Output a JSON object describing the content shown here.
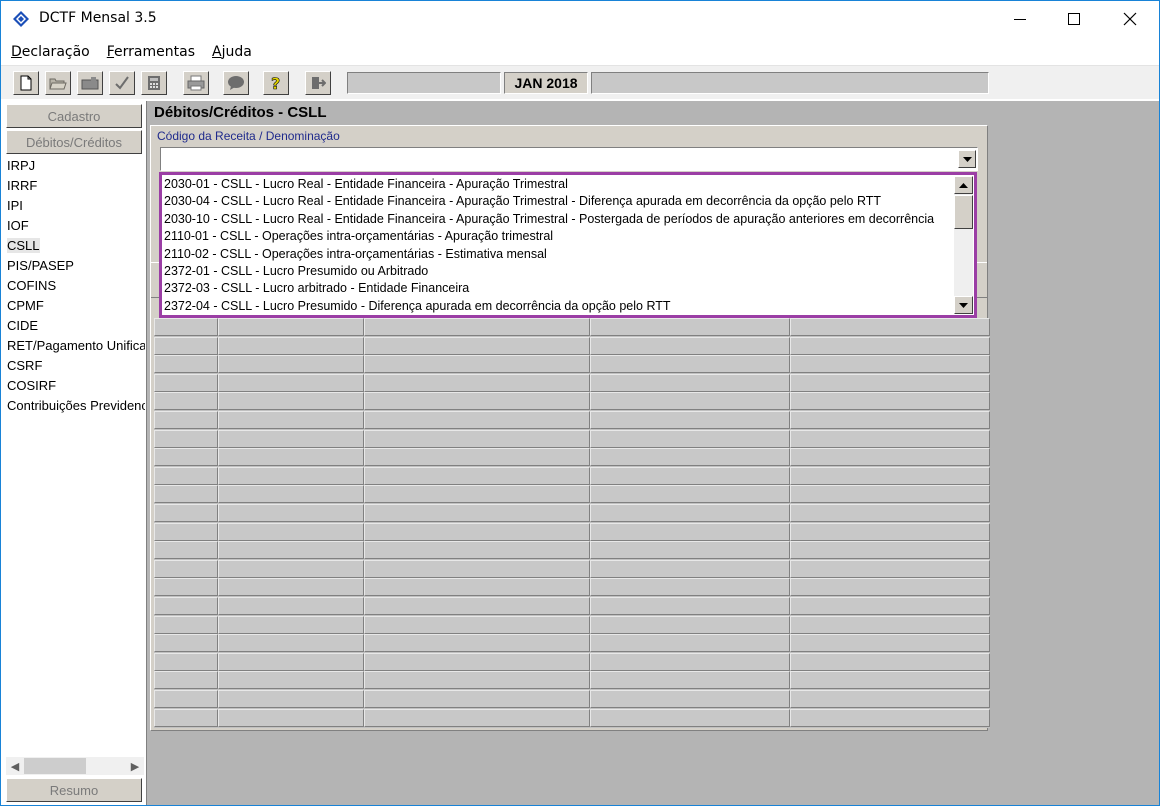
{
  "window": {
    "title": "DCTF Mensal 3.5"
  },
  "menu": {
    "items": [
      {
        "accel": "D",
        "rest": "eclaração"
      },
      {
        "accel": "F",
        "rest": "erramentas"
      },
      {
        "accel": "A",
        "rest": "juda"
      }
    ]
  },
  "toolbar": {
    "period": "JAN 2018",
    "icons": [
      "new-file-icon",
      "open-folder-icon",
      "save-icon",
      "check-icon",
      "calculator-icon",
      "print-icon",
      "speech-icon",
      "help-icon",
      "exit-icon"
    ]
  },
  "sidebar": {
    "cadastro_label": "Cadastro",
    "debitos_label": "Débitos/Créditos",
    "items": [
      "IRPJ",
      "IRRF",
      "IPI",
      "IOF",
      "CSLL",
      "PIS/PASEP",
      "COFINS",
      "CPMF",
      "CIDE",
      "RET/Pagamento Unificado",
      "CSRF",
      "COSIRF",
      "Contribuições Previdenciárias"
    ],
    "selected_index": 4,
    "resumo_label": "Resumo"
  },
  "main": {
    "title": "Débitos/Créditos - CSLL",
    "field_label": "Código da Receita / Denominação",
    "combo_value": ""
  },
  "dropdown": {
    "options": [
      "2030-01 - CSLL - Lucro Real - Entidade Financeira - Apuração Trimestral",
      "2030-04 - CSLL - Lucro Real - Entidade Financeira - Apuração Trimestral - Diferença apurada em decorrência da opção pelo RTT",
      "2030-10 - CSLL - Lucro Real - Entidade Financeira - Apuração Trimestral - Postergada de períodos de apuração anteriores em decorrência",
      "2110-01 - CSLL - Operações intra-orçamentárias - Apuração trimestral",
      "2110-02 - CSLL - Operações intra-orçamentárias - Estimativa mensal",
      "2372-01 - CSLL - Lucro Presumido ou Arbitrado",
      "2372-03 - CSLL - Lucro arbitrado - Entidade Financeira",
      "2372-04 - CSLL - Lucro Presumido - Diferença apurada em decorrência da opção pelo RTT"
    ]
  },
  "colors": {
    "highlight_border": "#9b3ea5",
    "field_label": "#1f2a8c",
    "main_background": "#b4b4b4"
  }
}
